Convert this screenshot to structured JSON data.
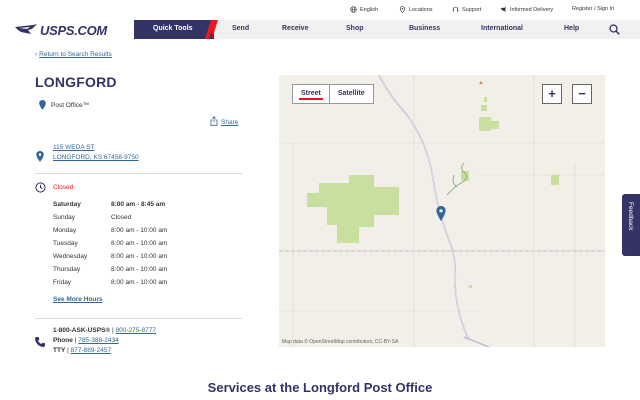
{
  "utility": {
    "english": "English",
    "locations": "Locations",
    "support": "Support",
    "informed_delivery": "Informed Delivery",
    "register": "Register / Sign In"
  },
  "logo": {
    "text": "USPS.COM"
  },
  "nav": {
    "quick_tools": "Quick Tools",
    "send": "Send",
    "receive": "Receive",
    "shop": "Shop",
    "business": "Business",
    "international": "International",
    "help": "Help"
  },
  "back_link": "Return to Search Results",
  "page_title": "LONGFORD",
  "po_type": "Post Office™",
  "share": "Share",
  "address": {
    "line1": "115 WEDA ST",
    "line2": "LONGFORD, KS 67458-9750"
  },
  "status": "Closed",
  "hours": [
    {
      "day": "Saturday",
      "time": "8:00 am - 8:45 am",
      "current": true
    },
    {
      "day": "Sunday",
      "time": "Closed",
      "current": false
    },
    {
      "day": "Monday",
      "time": "8:00 am - 10:00 am",
      "current": false
    },
    {
      "day": "Tuesday",
      "time": "8:00 am - 10:00 am",
      "current": false
    },
    {
      "day": "Wednesday",
      "time": "8:00 am - 10:00 am",
      "current": false
    },
    {
      "day": "Thursday",
      "time": "8:00 am - 10:00 am",
      "current": false
    },
    {
      "day": "Friday",
      "time": "8:00 am - 10:00 am",
      "current": false
    }
  ],
  "see_more_hours": "See More Hours",
  "contact": {
    "main": "1-800-ASK-USPS®",
    "main_alt": "800-275-8777",
    "phone_label": "Phone",
    "phone": "785-388-2434",
    "tty_label": "TTY",
    "tty": "877-889-2457",
    "separator": "|"
  },
  "map": {
    "street": "Street",
    "satellite": "Satellite",
    "zoom_in": "+",
    "zoom_out": "−",
    "attribution": "Map data © OpenStreetMap contributors, CC-BY-SA"
  },
  "feedback": "Feedback",
  "services_title": "Services at the Longford Post Office",
  "colors": {
    "brand_navy": "#333366",
    "brand_red": "#e71921",
    "link_blue": "#336699",
    "map_bg": "#f2efe9",
    "park_green": "#c8dfa0"
  }
}
